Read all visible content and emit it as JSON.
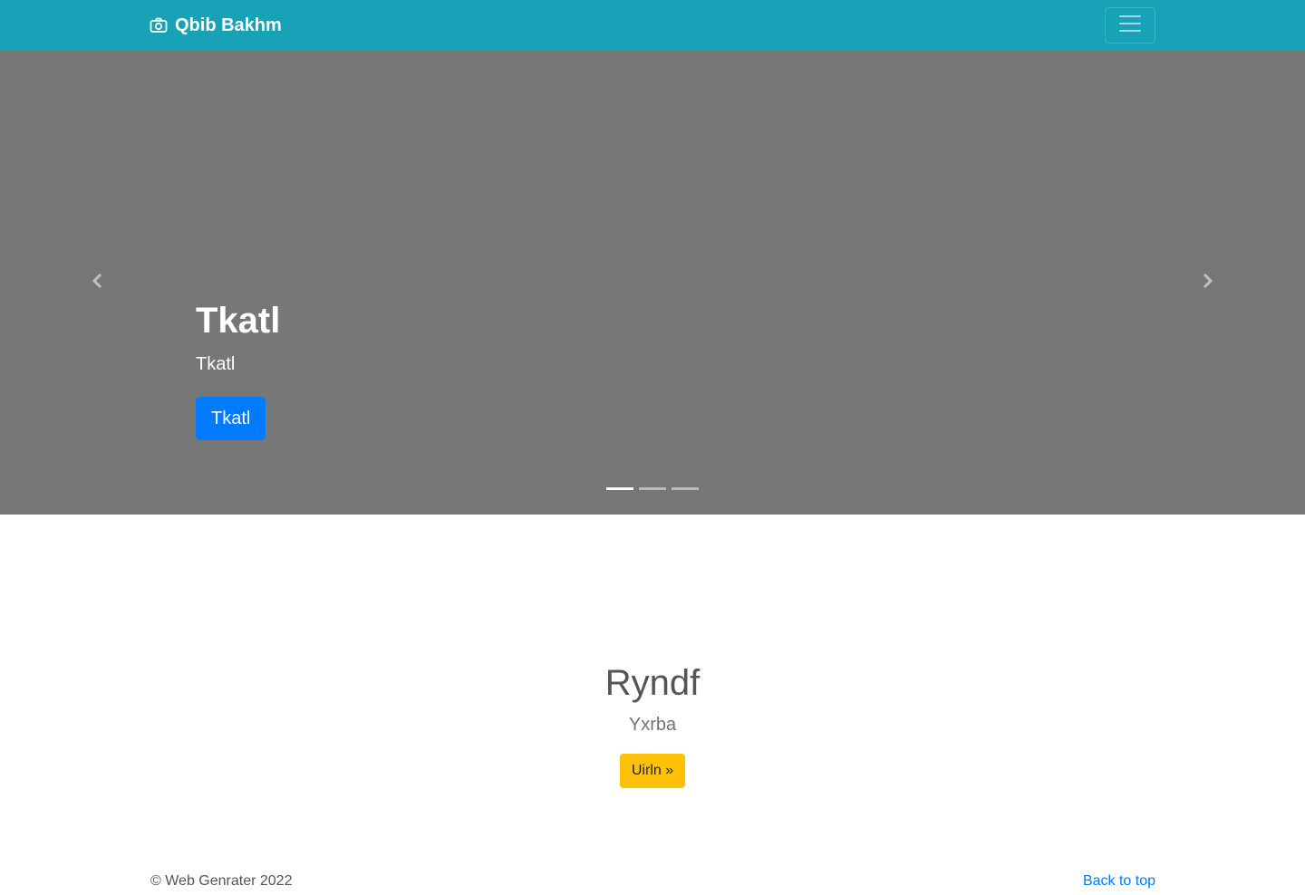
{
  "navbar": {
    "brand": "Qbib Bakhm",
    "brand_icon": "camera-icon",
    "toggler_icon": "hamburger-menu-icon",
    "background": "#17a2b8"
  },
  "carousel": {
    "background": "#777777",
    "slide": {
      "title": "Tkatl",
      "subtitle": "Tkatl",
      "button_label": "Tkatl"
    },
    "prev_icon": "chevron-left-icon",
    "next_icon": "chevron-right-icon",
    "indicator_count": 3,
    "active_indicator": 1
  },
  "section": {
    "heading": "Ryndf",
    "lead": "Yxrba",
    "button_label": "Uirln »"
  },
  "footer": {
    "copyright": "© Web Genrater 2022",
    "back_to_top": "Back to top"
  },
  "colors": {
    "primary": "#007bff",
    "warning": "#ffc107",
    "info": "#17a2b8"
  }
}
